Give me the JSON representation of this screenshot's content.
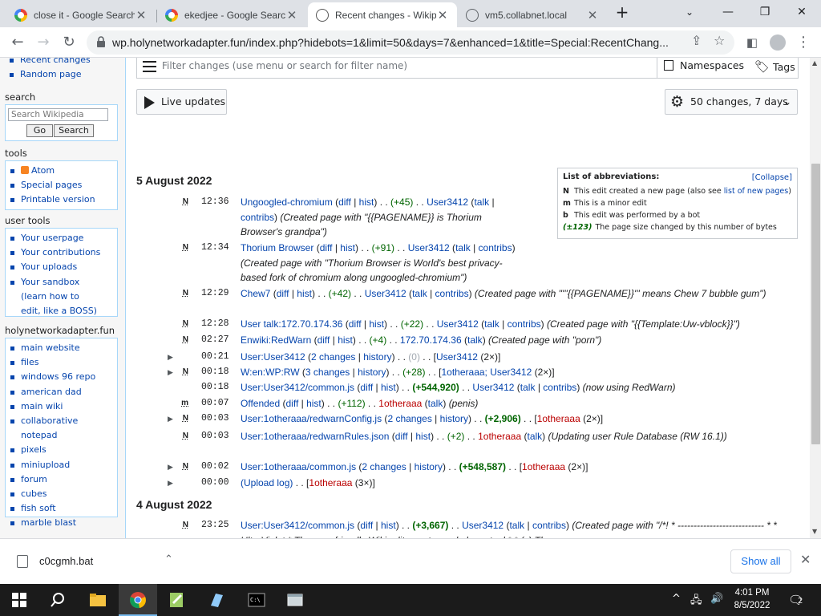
{
  "browser": {
    "tabs": [
      {
        "title": "close it - Google Search",
        "icon": "google-icon"
      },
      {
        "title": "ekedjee - Google Search",
        "icon": "google-icon"
      },
      {
        "title": "Recent changes - Wikipedia",
        "icon": "wikipedia-icon"
      },
      {
        "title": "vm5.collabnet.local",
        "icon": "globe-icon"
      }
    ],
    "url": "wp.holynetworkadapter.fun/index.php?hidebots=1&limit=50&days=7&enhanced=1&title=Special:RecentChang..."
  },
  "sidebar": {
    "nav_items": [
      "Recent changes",
      "Random page"
    ],
    "search": {
      "heading": "search",
      "placeholder": "Search Wikipedia",
      "go": "Go",
      "search": "Search"
    },
    "tools": {
      "heading": "tools",
      "items": [
        "Atom",
        "Special pages",
        "Printable version"
      ]
    },
    "user_tools": {
      "heading": "user tools",
      "items": [
        "Your userpage",
        "Your contributions",
        "Your uploads",
        "Your sandbox (learn how to edit, like a BOSS)"
      ]
    },
    "site": {
      "heading": "holynetworkadapter.fun",
      "items": [
        "main website",
        "files",
        "windows 96 repo",
        "american dad",
        "main wiki",
        "collaborative notepad",
        "pixels",
        "miniupload",
        "forum",
        "cubes",
        "fish soft",
        "marble blast"
      ]
    }
  },
  "filters": {
    "placeholder": "Filter changes (use menu or search for filter name)",
    "namespaces": "Namespaces",
    "tags": "Tags",
    "live_updates": "Live updates",
    "changes_selector": "50 changes, 7 days"
  },
  "legend": {
    "title": "List of abbreviations:",
    "collapse": "[Collapse]",
    "rows": [
      {
        "key": "N",
        "text": "This edit created a new page (also see ",
        "link": "list of new pages",
        "tail": ")"
      },
      {
        "key": "m",
        "text": "This is a minor edit"
      },
      {
        "key": "b",
        "text": "This edit was performed by a bot"
      },
      {
        "key": "(±123)",
        "text": "The page size changed by this number of bytes"
      }
    ]
  },
  "days": [
    {
      "date": "5 August 2022",
      "changes": [
        {
          "flag": "N",
          "time": "12:36",
          "title": "Ungoogled-chromium",
          "diff": "+45",
          "user": "User3412",
          "summary": "(Created page with \"{{PAGENAME}} is Thorium Browser's grandpa\")"
        },
        {
          "flag": "N",
          "time": "12:34",
          "title": "Thorium Browser",
          "diff": "+91",
          "user": "User3412",
          "summary": "(Created page with \"Thorium Browser is World's best privacy-based fork of chromium along ungoogled-chromium\")"
        },
        {
          "flag": "N",
          "time": "12:29",
          "title": "Chew7",
          "diff": "+42",
          "user": "User3412",
          "summary": "(Created page with \"'''{{PAGENAME}}''' means Chew 7 bubble gum\")"
        },
        {
          "flag": "N",
          "time": "12:28",
          "title": "User talk:172.70.174.36",
          "diff": "+22",
          "user": "User3412",
          "summary": "(Created page with \"{{Template:Uw-vblock}}\")"
        },
        {
          "flag": "N",
          "time": "02:27",
          "title": "Enwiki:RedWarn",
          "diff": "+4",
          "user": "172.70.174.36",
          "summary": "(Created page with \"porn\")"
        },
        {
          "flag": "",
          "time": "00:21",
          "title": "User:User3412",
          "group": "2 changes",
          "diff": "0",
          "user": "User3412",
          "count": "2×"
        },
        {
          "flag": "N",
          "time": "00:18",
          "title": "W:en:WP:RW",
          "group": "3 changes",
          "diff": "+28",
          "user": "1otheraaa; User3412",
          "count": "2×"
        },
        {
          "flag": "",
          "time": "00:18",
          "title": "User:User3412/common.js",
          "diff": "+544,920",
          "user": "User3412",
          "summary": "(now using RedWarn)"
        },
        {
          "flag": "m",
          "time": "00:07",
          "title": "Offended",
          "diff": "+112",
          "user": "1otheraaa",
          "summary": "(penis)"
        },
        {
          "flag": "N",
          "time": "00:03",
          "title": "User:1otheraaa/redwarnConfig.js",
          "group": "2 changes",
          "diff": "+2,906",
          "user": "1otheraaa",
          "count": "2×"
        },
        {
          "flag": "N",
          "time": "00:03",
          "title": "User:1otheraaa/redwarnRules.json",
          "diff": "+2",
          "user": "1otheraaa",
          "summary": "(Updating user Rule Database (RW 16.1))"
        },
        {
          "flag": "N",
          "time": "00:02",
          "title": "User:1otheraaa/common.js",
          "group": "2 changes",
          "diff": "+548,587",
          "user": "1otheraaa",
          "count": "2×"
        },
        {
          "flag": "",
          "time": "00:00",
          "title": "(Upload log)",
          "user": "1otheraaa",
          "count": "3×"
        }
      ]
    },
    {
      "date": "4 August 2022",
      "changes": [
        {
          "flag": "N",
          "time": "23:25",
          "title": "User:User3412/common.js",
          "diff": "+3,667",
          "user": "User3412",
          "summary": "(Created page with \"/*! * --------------------------- * * UltraViolet * The user friendly Wiki edit counter and abuse tool * * (c) The"
        }
      ]
    }
  ],
  "links": {
    "diff": "diff",
    "hist": "hist",
    "history": "history",
    "talk": "talk",
    "contribs": "contribs"
  },
  "download": {
    "file": "c0cgmh.bat",
    "show_all": "Show all"
  },
  "taskbar": {
    "time": "4:01 PM",
    "date": "8/5/2022",
    "notifications": "2"
  }
}
